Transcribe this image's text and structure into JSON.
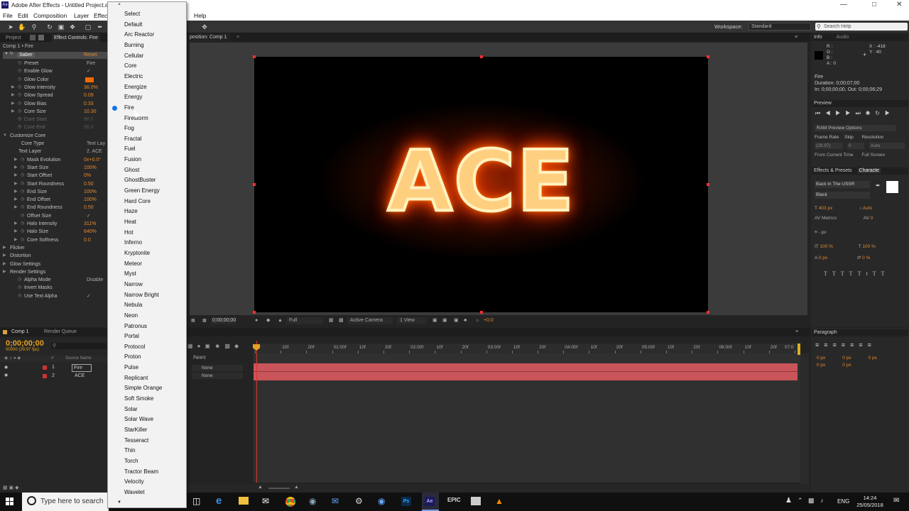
{
  "window": {
    "title": "Adobe After Effects - Untitled Project.a",
    "app_icon": "Ae"
  },
  "menu": {
    "items": [
      "File",
      "Edit",
      "Composition",
      "Layer",
      "Effect",
      "Help"
    ]
  },
  "toolbar": {
    "workspace_label": "Workspace:",
    "workspace_value": "Standard",
    "search_placeholder": "Search Help"
  },
  "effect_controls": {
    "tabs": [
      "Project",
      "Effect Controls: Fire"
    ],
    "breadcrumb": "Comp 1 • Fire",
    "effect_name": "Saber",
    "reset_label": "Reset",
    "rows": [
      {
        "label": "Preset",
        "value": "Fire"
      },
      {
        "label": "Enable Glow",
        "value": "✓"
      },
      {
        "label": "Glow Color",
        "value": ""
      },
      {
        "label": "Glow Intensity",
        "value": "36.0%"
      },
      {
        "label": "Glow Spread",
        "value": "0.09"
      },
      {
        "label": "Glow Bias",
        "value": "0.33"
      },
      {
        "label": "Core Size",
        "value": "10.30"
      },
      {
        "label": "Core Start",
        "value": "96.0"
      },
      {
        "label": "Core End",
        "value": "96.0"
      },
      {
        "label": "Customize Core",
        "value": ""
      },
      {
        "label": "Core Type",
        "value": "Text Lay"
      },
      {
        "label": "Text Layer",
        "value": "2. ACE"
      },
      {
        "label": "Mask Evolution",
        "value": "0x+0.0°"
      },
      {
        "label": "Start Size",
        "value": "100%"
      },
      {
        "label": "Start Offset",
        "value": "0%"
      },
      {
        "label": "Start Roundness",
        "value": "0.50"
      },
      {
        "label": "End Size",
        "value": "100%"
      },
      {
        "label": "End Offset",
        "value": "100%"
      },
      {
        "label": "End Roundness",
        "value": "0.50"
      },
      {
        "label": "Offset Size",
        "value": "✓"
      },
      {
        "label": "Halo Intensity",
        "value": "311%"
      },
      {
        "label": "Halo Size",
        "value": "640%"
      },
      {
        "label": "Core Softness",
        "value": "0.0"
      },
      {
        "label": "Flicker",
        "value": ""
      },
      {
        "label": "Distortion",
        "value": ""
      },
      {
        "label": "Glow Settings",
        "value": ""
      },
      {
        "label": "Render Settings",
        "value": ""
      },
      {
        "label": "Alpha Mode",
        "value": "Disable"
      },
      {
        "label": "Invert Masks",
        "value": ""
      },
      {
        "label": "Use Text Alpha",
        "value": "✓"
      }
    ]
  },
  "preset_dropdown": {
    "selected": "Fire",
    "items": [
      "Select",
      "Default",
      "Arc Reactor",
      "Burning",
      "Cellular",
      "Core",
      "Electric",
      "Energize",
      "Energy",
      "Fire",
      "Firestorm",
      "Fog",
      "Fractal",
      "Fuel",
      "Fusion",
      "Ghost",
      "GhostBuster",
      "Green Energy",
      "Hard Core",
      "Haze",
      "Heat",
      "Hot",
      "Inferno",
      "Kryptonite",
      "Meteor",
      "Myst",
      "Narrow",
      "Narrow Bright",
      "Nebula",
      "Neon",
      "Patronus",
      "Portal",
      "Protocol",
      "Proton",
      "Pulse",
      "Replicant",
      "Simple Orange",
      "Soft Smoke",
      "Solar",
      "Solar Wave",
      "StarKiller",
      "Tesseract",
      "Thin",
      "Torch",
      "Tractor Beam",
      "Velocity",
      "Wavelet"
    ]
  },
  "composition": {
    "tab": "position: Comp 1",
    "viewer_text": "ACE",
    "footer": {
      "timecode": "0;00;00;00",
      "resolution": "Full",
      "camera": "Active Camera",
      "views": "1 View",
      "exposure": "+0.0"
    }
  },
  "info_panel": {
    "tabs": [
      "Info",
      "Audio"
    ],
    "rgba": [
      "R :",
      "G :",
      "B :",
      "A : 0"
    ],
    "coords": [
      "X : -418",
      "Y : 40"
    ],
    "layer_name": "Fire",
    "duration": "Duration: 0;00;07;00",
    "in_out": "In: 0;00;00;00, Out: 0;00;06;29"
  },
  "preview_panel": {
    "tab": "Preview",
    "ram_options": "RAM Preview Options",
    "labels": [
      "Frame Rate",
      "Skip",
      "Resolution"
    ],
    "values": [
      "(29.97)",
      "0",
      "Auto"
    ],
    "checks": [
      "From Current Time",
      "Full Screen"
    ]
  },
  "character_panel": {
    "tabs": [
      "Effects & Presets",
      "Characte"
    ],
    "font": "Back In The USSR",
    "style": "Black",
    "size": "403 px",
    "leading": "Auto",
    "kerning": "Metrics",
    "tracking": "0",
    "stroke": "- px",
    "vscale": "100 %",
    "hscale": "100 %",
    "baseline": "0 px",
    "tsume": "0 %"
  },
  "timeline": {
    "tabs": [
      "Comp 1",
      "Render Queue"
    ],
    "timecode": "0;00;00;00",
    "fps": "00000 (29.97 fps)",
    "columns": [
      "#",
      "Source Name",
      "Parent"
    ],
    "layers": [
      {
        "num": "1",
        "name": "Fire",
        "parent": "None"
      },
      {
        "num": "2",
        "name": "ACE",
        "parent": "None"
      }
    ],
    "ruler": [
      "0f",
      "10f",
      "20f",
      "01:00f",
      "10f",
      "20f",
      "02:00f",
      "10f",
      "20f",
      "03:00f",
      "10f",
      "20f",
      "04:00f",
      "10f",
      "20f",
      "05:00f",
      "10f",
      "20f",
      "06:00f",
      "10f",
      "20f",
      "07:0"
    ]
  },
  "paragraph_panel": {
    "tab": "Paragraph",
    "values": [
      "0 px",
      "0 px",
      "0 px",
      "0 px",
      "0 px"
    ]
  },
  "taskbar": {
    "search_placeholder": "Type here to search",
    "language": "ENG",
    "time": "14:24",
    "date": "25/05/2018"
  },
  "colors": {
    "accent": "#e68a2e",
    "layer_bar": "#c9545a",
    "select_blue": "#1473e6",
    "glow_swatch": "#f06a00"
  }
}
